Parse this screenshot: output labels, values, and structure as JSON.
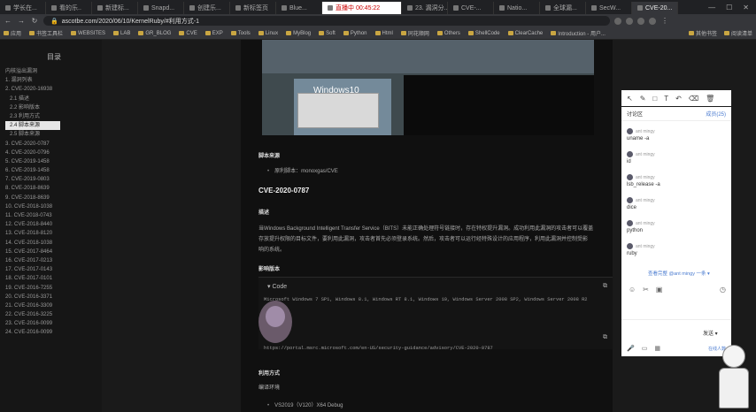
{
  "tabs": [
    {
      "label": "学长在..."
    },
    {
      "label": "看的乐.."
    },
    {
      "label": "新建标..."
    },
    {
      "label": "Snapd..."
    },
    {
      "label": "创建乐..."
    },
    {
      "label": "新标签页"
    },
    {
      "label": "Blue..."
    },
    {
      "label": "直播中 00:45:22",
      "state": "live"
    },
    {
      "label": "23. 漏洞分..."
    },
    {
      "label": "CVE-..."
    },
    {
      "label": "Natio..."
    },
    {
      "label": "全球漏..."
    },
    {
      "label": "SecW..."
    },
    {
      "label": "CVE-20...",
      "state": "active"
    }
  ],
  "address": {
    "url": "ascotbe.com/2020/06/10/KernelRuby/#利用方式-1"
  },
  "bookmarks": [
    "应用",
    "书签工具栏",
    "WEBSITES",
    "LAB",
    "GR_BLOG",
    "CVE",
    "EXP",
    "Tools",
    "Linux",
    "MyBlog",
    "Soft",
    "Python",
    "Html",
    "同花顺网",
    "Others",
    "ShellCode",
    "ClearCache",
    "Introduction - 用户...",
    "其他书签",
    "阅读清单"
  ],
  "toc": {
    "title": "目录",
    "items": [
      {
        "label": "内核溢出漏洞",
        "level": 0
      },
      {
        "label": "1. 漏洞列表",
        "level": 0
      },
      {
        "label": "2. CVE-2020-16938",
        "level": 0
      },
      {
        "label": "2.1 描述",
        "level": 1
      },
      {
        "label": "2.2 影响版本",
        "level": 1
      },
      {
        "label": "2.3 利用方式",
        "level": 1
      },
      {
        "label": "2.4 脚本来源",
        "level": 1,
        "active": true
      },
      {
        "label": "2.5 脚本来源",
        "level": 1
      },
      {
        "label": "3. CVE-2020-0787",
        "level": 0
      },
      {
        "label": "4. CVE-2020-0796",
        "level": 0
      },
      {
        "label": "5. CVE-2019-1458",
        "level": 0
      },
      {
        "label": "6. CVE-2019-1458",
        "level": 0
      },
      {
        "label": "7. CVE-2019-0803",
        "level": 0
      },
      {
        "label": "8. CVE-2018-8639",
        "level": 0
      },
      {
        "label": "9. CVE-2018-8639",
        "level": 0
      },
      {
        "label": "10. CVE-2018-1038",
        "level": 0
      },
      {
        "label": "11. CVE-2018-0743",
        "level": 0
      },
      {
        "label": "12. CVE-2018-8440",
        "level": 0
      },
      {
        "label": "13. CVE-2018-8120",
        "level": 0
      },
      {
        "label": "14. CVE-2018-1038",
        "level": 0
      },
      {
        "label": "15. CVE-2017-8464",
        "level": 0
      },
      {
        "label": "16. CVE-2017-0213",
        "level": 0
      },
      {
        "label": "17. CVE-2017-0143",
        "level": 0
      },
      {
        "label": "18. CVE-2017-0101",
        "level": 0
      },
      {
        "label": "19. CVE-2016-7255",
        "level": 0
      },
      {
        "label": "20. CVE-2016-3371",
        "level": 0
      },
      {
        "label": "21. CVE-2016-3309",
        "level": 0
      },
      {
        "label": "22. CVE-2016-3225",
        "level": 0
      },
      {
        "label": "23. CVE-2016-0099",
        "level": 0
      },
      {
        "label": "24. CVE-2016-0099",
        "level": 0
      }
    ]
  },
  "article": {
    "shot_logo": "Windows10",
    "script_source_heading": "脚本来源",
    "script_source_item": "原利脚本：monoxgas/CVE",
    "section_title": "CVE-2020-0787",
    "desc_heading": "描述",
    "desc_line1": "当Windows Background Intelligent Transfer Service（BITS）未能正确处理符号链接时，存在特权提升漏洞。成功利用此漏洞的攻击者可以覆盖",
    "desc_line2": "存放提升权限的目标文件，要利用此漏洞，攻击者首先必须登录系统。然后，攻击者可以运行经特殊设计的应用程序，利用此漏洞并控制受影",
    "desc_line3": "响的系统。",
    "affected_heading": "影响版本",
    "code_label": "Code",
    "code_line1": "Microsoft Windows 7 SP1, Windows 8.1, Windows RT 8.1, Windows 10, Windows Server 2008 SP2, Windows Server 2008 R2",
    "code_line2": "https://portal.msrc.microsoft.com/en-US/security-guidance/advisory/CVE-2020-0787",
    "exploit_heading": "利用方式",
    "env_heading": "编译环境",
    "env_item": "VS2019（V120）X64 Debug"
  },
  "chat": {
    "title": "讨论区",
    "members": "成员(25)",
    "messages": [
      {
        "user": "ant mingy",
        "text": "uname -a"
      },
      {
        "user": "ant mingy",
        "text": "id"
      },
      {
        "user": "ant mingy",
        "text": "lsb_release -a"
      },
      {
        "user": "ant mingy",
        "text": "dice"
      },
      {
        "user": "ant mingy",
        "text": "python"
      },
      {
        "user": "ant mingy",
        "text": "ruby"
      }
    ],
    "more_link": "查看完整 @ant mingy 一条 ▾",
    "send": "发送",
    "footer_tag": "在线人数"
  }
}
